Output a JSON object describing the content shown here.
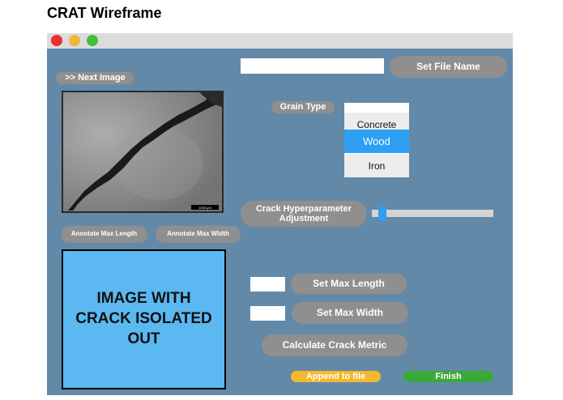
{
  "page_title": "CRAT Wireframe",
  "colors": {
    "window_bg": "#6389a9",
    "pill_gray": "#8f8f8f",
    "isolated_panel": "#5bb8f0",
    "selected_option": "#2e9ff2",
    "append_button": "#f5b72d",
    "finish_button": "#3aa83a"
  },
  "window": {
    "traffic_lights": [
      "close",
      "minimize",
      "maximize"
    ]
  },
  "controls": {
    "set_file_name": "Set File Name",
    "file_name_value": "",
    "next_image": ">> Next Image",
    "grain_type_label": "Grain Type",
    "grain_options": [
      "Concrete",
      "Wood",
      "Iron"
    ],
    "grain_selected": "Wood",
    "hyperparam_label": "Crack Hyperparameter Adjustment",
    "slider_value_fraction": 0.06,
    "annotate_max_length": "Annotate Max Length",
    "annotate_max_width": "Annotate Max Width",
    "set_max_length": "Set Max Length",
    "max_length_value": "",
    "set_max_width": "Set Max Width",
    "max_width_value": "",
    "calculate_metric": "Calculate Crack Metric",
    "append_to_file": "Append to file",
    "finish": "Finish"
  },
  "image": {
    "scale_bar_label": "1000 µm"
  },
  "isolated_panel": {
    "text": "IMAGE WITH CRACK ISOLATED OUT"
  }
}
